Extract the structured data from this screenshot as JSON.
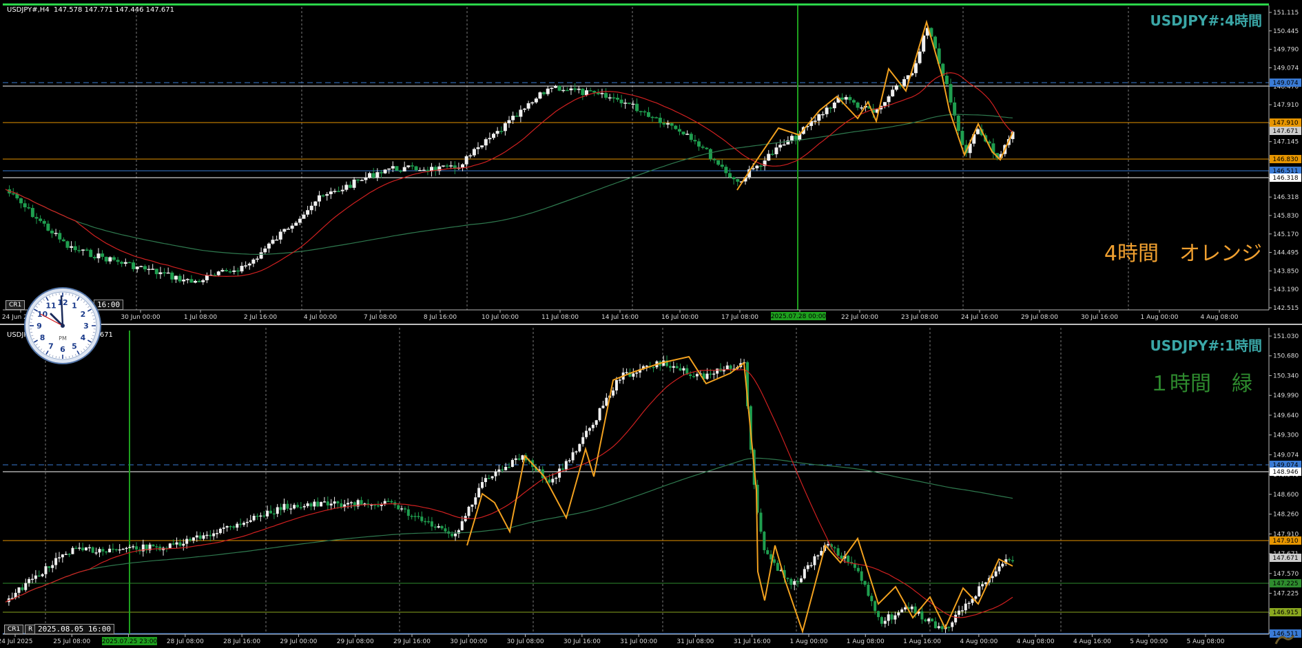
{
  "chart1": {
    "info": "USDJPY#,H4  147.578 147.771 147.446 147.671",
    "big_title": "USDJPY#:4時間",
    "label": "4時間　オレンジ",
    "label_color": "#f0a030",
    "y_ticks": [
      "151.115",
      "150.445",
      "149.790",
      "149.074",
      "148.470",
      "147.910",
      "147.671",
      "147.145",
      "146.830",
      "146.511",
      "146.318",
      "145.830",
      "145.170",
      "144.495",
      "143.850",
      "143.190",
      "142.515"
    ],
    "price_tags": [
      {
        "text": "149.074",
        "color": "#3a7bd5"
      },
      {
        "text": "147.910",
        "color": "#e69500"
      },
      {
        "text": "147.671",
        "color": "#cccccc"
      },
      {
        "text": "146.830",
        "color": "#e69500"
      },
      {
        "text": "146.511",
        "color": "#3a7bd5"
      },
      {
        "text": "146.318",
        "color": "#ffffff"
      }
    ],
    "x_ticks": [
      "24 Jun 2025",
      "27 Jun 16:00",
      "30 Jun 00:00",
      "1 Jul 08:00",
      "2 Jul 16:00",
      "4 Jul 00:00",
      "7 Jul 08:00",
      "8 Jul 16:00",
      "10 Jul 00:00",
      "11 Jul 08:00",
      "14 Jul 16:00",
      "16 Jul 00:00",
      "17 Jul 08:00",
      "18 Jul 16:00",
      "22 Jul 00:00",
      "23 Jul 08:00",
      "24 Jul 16:00",
      "29 Jul 08:00",
      "30 Jul 16:00",
      "1 Aug 00:00",
      "4 Aug 08:00"
    ],
    "cursor_time": "2025.07.28 00:00",
    "cr_label": "CR1",
    "time_box": "16:00"
  },
  "chart2": {
    "info": "USDJPY#,H1  147.534 147.671",
    "big_title": "USDJPY#:1時間",
    "label": "１時間　緑",
    "label_color": "#2e8b2e",
    "y_ticks": [
      "151.030",
      "150.680",
      "150.340",
      "149.990",
      "149.640",
      "149.300",
      "149.074",
      "148.946",
      "148.600",
      "148.260",
      "147.910",
      "147.671",
      "147.570",
      "147.225",
      "146.880",
      "146.511"
    ],
    "price_tags": [
      {
        "text": "149.074",
        "color": "#3a7bd5"
      },
      {
        "text": "148.946",
        "color": "#ffffff"
      },
      {
        "text": "147.910",
        "color": "#e69500"
      },
      {
        "text": "147.671",
        "color": "#cccccc"
      },
      {
        "text": "147.225",
        "color": "#2e8b2e"
      },
      {
        "text": "146.915",
        "color": "#8aa820"
      },
      {
        "text": "146.511",
        "color": "#3a7bd5"
      }
    ],
    "x_ticks": [
      "24 Jul 2025",
      "25 Jul 08:00",
      "25 Jul 16:00",
      "28 Jul 08:00",
      "28 Jul 16:00",
      "29 Jul 00:00",
      "29 Jul 08:00",
      "29 Jul 16:00",
      "30 Jul 00:00",
      "30 Jul 08:00",
      "30 Jul 16:00",
      "31 Jul 00:00",
      "31 Jul 08:00",
      "31 Jul 16:00",
      "1 Aug 00:00",
      "1 Aug 08:00",
      "1 Aug 16:00",
      "4 Aug 00:00",
      "4 Aug 08:00",
      "4 Aug 16:00",
      "5 Aug 00:00",
      "5 Aug 08:00"
    ],
    "cursor_time": "2025.07.25 23:00",
    "cr_label": "CR1",
    "r_label": "R",
    "time_box": "2025.08.05 16:00"
  },
  "clock": {
    "pm_label": "PM",
    "numbers": [
      "12",
      "1",
      "2",
      "3",
      "4",
      "5",
      "6",
      "7",
      "8",
      "9",
      "10",
      "11"
    ]
  },
  "colors": {
    "bull": "#f0f0f0",
    "bear": "#1f9e4f",
    "ma_fast": "#d02020",
    "ma_slow": "#2f7a4f",
    "zigzag": "#f2a11f",
    "grid": "#9a9a9a"
  }
}
